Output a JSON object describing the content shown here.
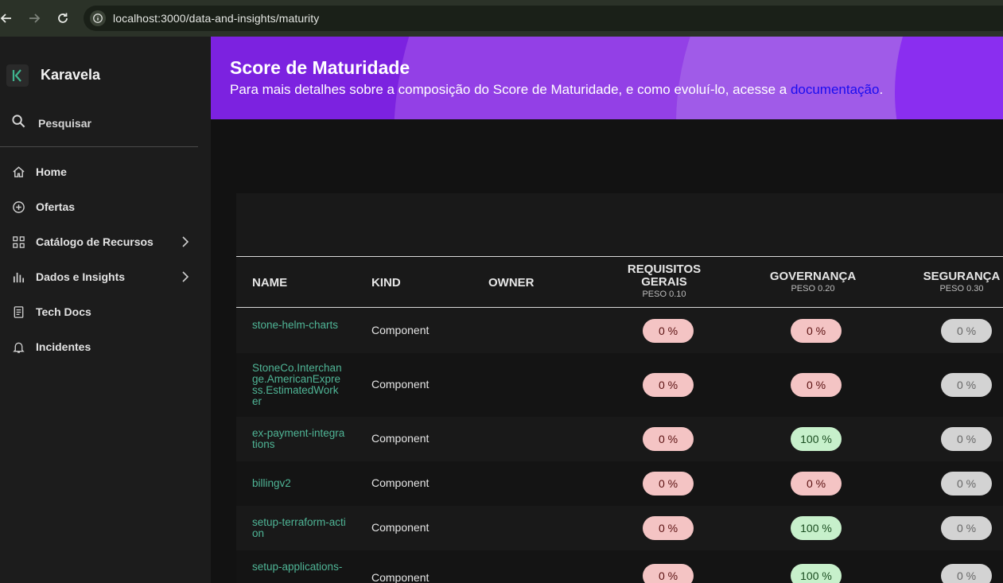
{
  "browser": {
    "url": "localhost:3000/data-and-insights/maturity"
  },
  "sidebar": {
    "app_name": "Karavela",
    "search_label": "Pesquisar",
    "items": [
      {
        "label": "Home",
        "icon": "home-icon"
      },
      {
        "label": "Ofertas",
        "icon": "plus-circle-icon"
      },
      {
        "label": "Catálogo de Recursos",
        "icon": "grid-icon",
        "expandable": true
      },
      {
        "label": "Dados e Insights",
        "icon": "bar-chart-icon",
        "expandable": true
      },
      {
        "label": "Tech Docs",
        "icon": "document-icon"
      },
      {
        "label": "Incidentes",
        "icon": "bell-icon"
      }
    ]
  },
  "banner": {
    "title": "Score de Maturidade",
    "subtitle": "Para mais detalhes sobre a composição do Score de Maturidade, e como evoluí-lo, acesse a ",
    "link_text": "documentação",
    "subtitle_end": "."
  },
  "table": {
    "columns": [
      {
        "label": "NAME"
      },
      {
        "label": "KIND"
      },
      {
        "label": "OWNER"
      },
      {
        "label": "REQUISITOS GERAIS",
        "weight": "PESO 0.10"
      },
      {
        "label": "GOVERNANÇA",
        "weight": "PESO 0.20"
      },
      {
        "label": "SEGURANÇA",
        "weight": "PESO 0.30"
      }
    ],
    "rows": [
      {
        "name": "stone-helm-charts",
        "kind": "Component",
        "owner": "",
        "req": "0 %",
        "gov": "0 %",
        "seg": "0 %"
      },
      {
        "name": "StoneCo.Interchange.AmericanExpress.EstimatedWorker",
        "kind": "Component",
        "owner": "",
        "req": "0 %",
        "gov": "0 %",
        "seg": "0 %"
      },
      {
        "name": "ex-payment-integrations",
        "kind": "Component",
        "owner": "",
        "req": "0 %",
        "gov": "100 %",
        "seg": "0 %"
      },
      {
        "name": "billingv2",
        "kind": "Component",
        "owner": "",
        "req": "0 %",
        "gov": "0 %",
        "seg": "0 %"
      },
      {
        "name": "setup-terraform-action",
        "kind": "Component",
        "owner": "",
        "req": "0 %",
        "gov": "100 %",
        "seg": "0 %"
      },
      {
        "name": "setup-applications-",
        "kind": "Component",
        "owner": "",
        "req": "0 %",
        "gov": "100 %",
        "seg": "0 %"
      }
    ]
  },
  "colors": {
    "accent": "#7c22e0",
    "link": "#4fb596",
    "pill_red": "#f4c4c4",
    "pill_green": "#c7f0cb",
    "pill_gray": "#d3d3d3"
  }
}
